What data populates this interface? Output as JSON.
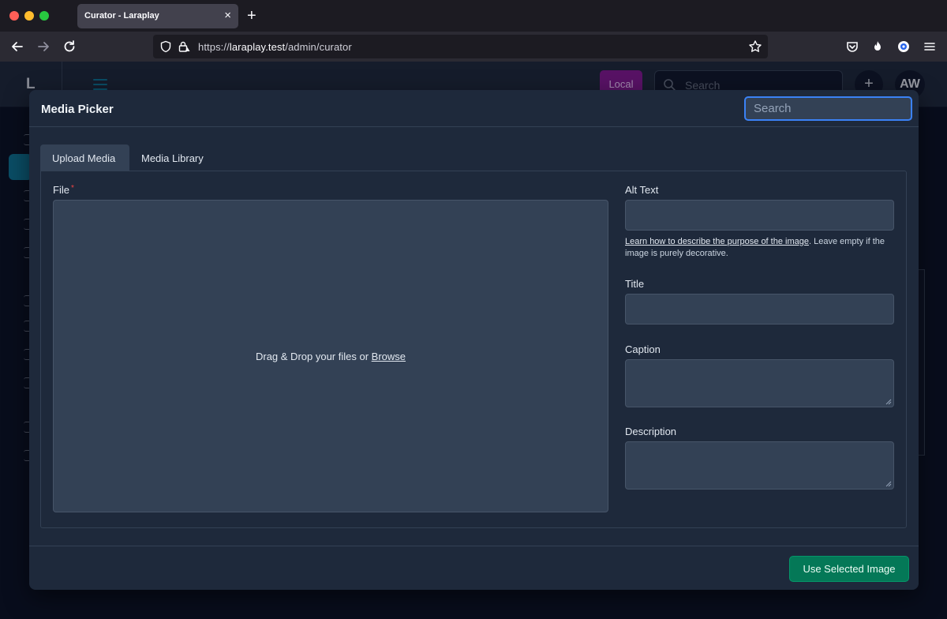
{
  "browser": {
    "tab_title": "Curator - Laraplay",
    "tab_close": "×",
    "new_tab": "+",
    "url_scheme": "https://",
    "url_host": "laraplay.test",
    "url_path": "/admin/curator"
  },
  "app": {
    "brand": "L",
    "environment_badge": "Local",
    "search_placeholder": "Search",
    "create_button": "+",
    "user_initials": "AW"
  },
  "modal": {
    "title": "Media Picker",
    "search_placeholder": "Search",
    "tabs": [
      {
        "label": "Upload Media",
        "active": true
      },
      {
        "label": "Media Library",
        "active": false
      }
    ],
    "file_label": "File",
    "required_marker": "*",
    "dropzone_text": "Drag & Drop your files or ",
    "dropzone_browse": "Browse",
    "alt_text_label": "Alt Text",
    "alt_help_link": "Learn how to describe the purpose of the image",
    "alt_help_text": ". Leave empty if the image is purely decorative.",
    "title_label": "Title",
    "caption_label": "Caption",
    "description_label": "Description",
    "submit_label": "Use Selected Image"
  },
  "colors": {
    "accent": "#3b82f6",
    "primary_button": "#047857",
    "env_badge": "#86198f",
    "required": "#ef4444"
  }
}
